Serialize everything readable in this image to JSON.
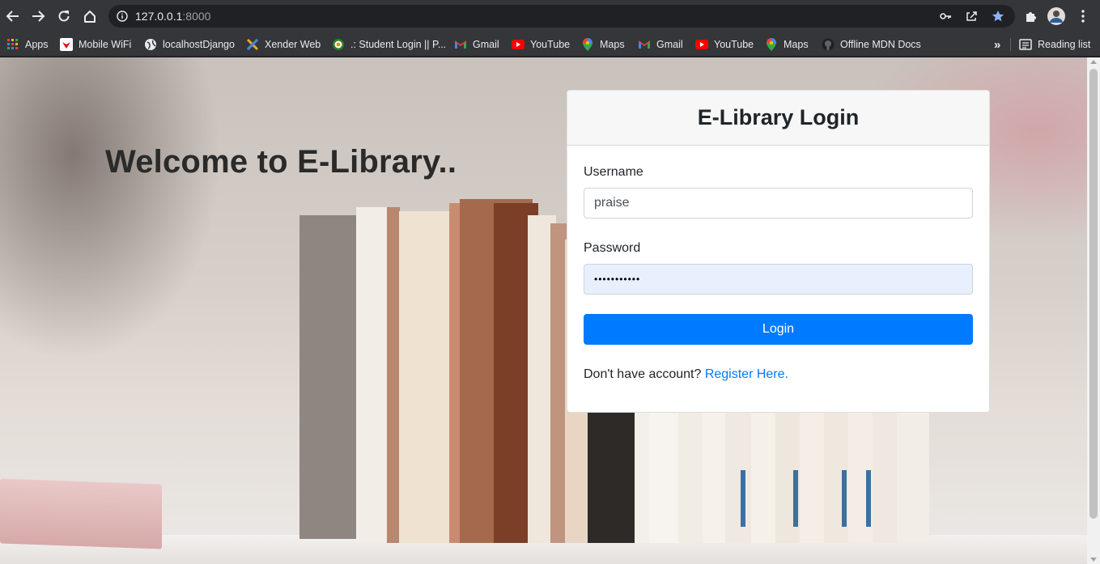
{
  "browser": {
    "url_host": "127.0.0.1",
    "url_port": ":8000",
    "bookmarks": [
      {
        "label": "Apps",
        "icon": "apps-grid-icon"
      },
      {
        "label": "Mobile WiFi",
        "icon": "huawei-icon"
      },
      {
        "label": "localhostDjango",
        "icon": "globe-icon"
      },
      {
        "label": "Xender Web",
        "icon": "xender-icon"
      },
      {
        "label": ".: Student Login || P...",
        "icon": "school-seal-icon"
      },
      {
        "label": "Gmail",
        "icon": "gmail-icon"
      },
      {
        "label": "YouTube",
        "icon": "youtube-icon"
      },
      {
        "label": "Maps",
        "icon": "maps-pin-icon"
      },
      {
        "label": "Gmail",
        "icon": "gmail-icon"
      },
      {
        "label": "YouTube",
        "icon": "youtube-icon"
      },
      {
        "label": "Maps",
        "icon": "maps-pin-icon"
      },
      {
        "label": "Offline MDN Docs",
        "icon": "github-icon"
      }
    ],
    "overflow_label": "»",
    "reading_list_label": "Reading list"
  },
  "page": {
    "welcome_heading": "Welcome to E-Library..",
    "card": {
      "title": "E-Library Login",
      "username_label": "Username",
      "username_value": "praise",
      "password_label": "Password",
      "password_value": "•••••••••••",
      "login_button": "Login",
      "register_prompt": "Don't have account?",
      "register_link": "Register Here."
    }
  },
  "colors": {
    "primary": "#007bff",
    "autofill_bg": "#e8f0fe",
    "chrome_bg": "#35363a"
  }
}
